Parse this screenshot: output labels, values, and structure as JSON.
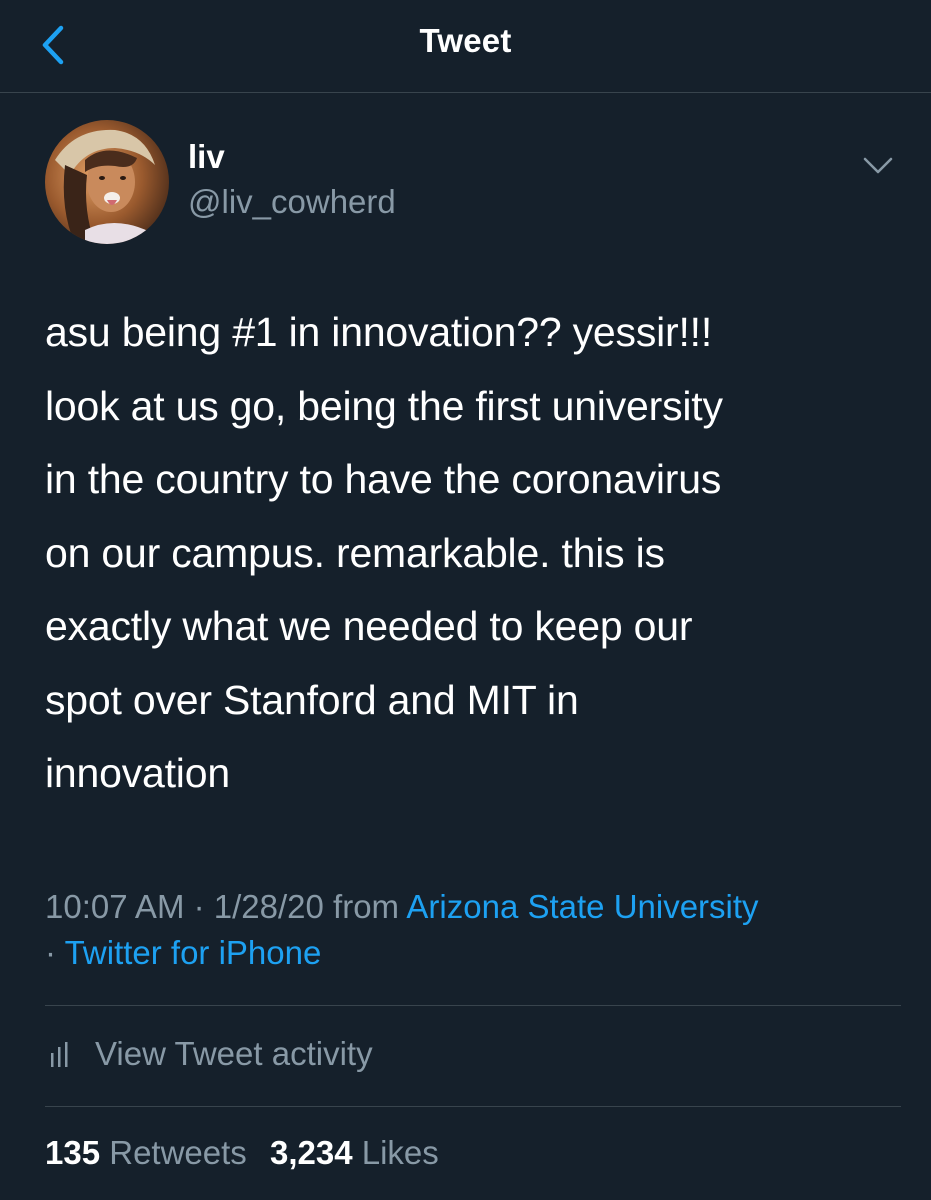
{
  "header": {
    "title": "Tweet",
    "back_icon": "chevron-left-icon"
  },
  "colors": {
    "background": "#15202b",
    "accent": "#1da1f2",
    "secondary_text": "#8899a6",
    "divider": "#38444d"
  },
  "author": {
    "display_name": "liv",
    "handle": "@liv_cowherd",
    "menu_icon": "chevron-down-icon"
  },
  "tweet": {
    "text": "asu being #1 in innovation?? yessir!!!\nlook at us go, being the first university\nin the country to have the coronavirus\non our campus. remarkable. this is\nexactly what we needed to keep our\nspot over Stanford and MIT in\ninnovation"
  },
  "meta": {
    "time": "10:07 AM",
    "sep1": " · ",
    "date": "1/28/20",
    "from": " from ",
    "location": "Arizona State University",
    "sep2": " · ",
    "source": "Twitter for iPhone"
  },
  "activity": {
    "icon": "bar-chart-icon",
    "label": "View Tweet activity"
  },
  "stats": {
    "retweets_count": "135",
    "retweets_label": "Retweets",
    "likes_count": "3,234",
    "likes_label": "Likes"
  }
}
